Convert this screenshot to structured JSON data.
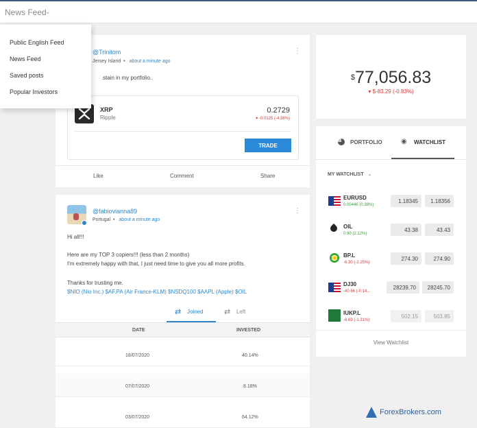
{
  "topbar": {
    "title": "News Feed"
  },
  "menu": {
    "items": [
      "Public English Feed",
      "News Feed",
      "Saved posts",
      "Popular Investors"
    ]
  },
  "post1": {
    "username": "@Trinitom",
    "location": "Jersey Island",
    "time": "about a minute ago",
    "text": "stain in my portfolio..",
    "instrument": {
      "symbol": "XRP",
      "name": "Ripple",
      "price": "0.2729",
      "change": "-0.0125 (-4.38%)",
      "trade_label": "TRADE"
    },
    "actions": {
      "like": "Like",
      "comment": "Comment",
      "share": "Share"
    }
  },
  "post2": {
    "username": "@fabiovianna89",
    "location": "Portugal",
    "time": "about a minute ago",
    "lines": [
      "Hi all!!!",
      "Here are my TOP 3 copiers!!! (less than 2 months)",
      "I'm extremely happy with that, I just need time to give you all more profits.",
      "Thanks for trusting me."
    ],
    "tags": "$NIO (Nio Inc.) $AF.PA (Air France-KLM) $NSDQ100 $AAPL (Apple) $OIL",
    "tabs": {
      "joined": "Joined",
      "left": "Left"
    },
    "table": {
      "headers": [
        "DATE",
        "INVESTED"
      ],
      "rows": [
        [
          "18/07/2020",
          "40.14%"
        ],
        [
          "07/07/2020",
          "8.18%"
        ],
        [
          "03/07/2020",
          "64.12%"
        ]
      ]
    }
  },
  "equity": {
    "currency": "$",
    "value": "77,056.83",
    "change": "$-83.29 (-0.83%)"
  },
  "watchlist": {
    "tabs": {
      "portfolio": "PORTFOLIO",
      "watchlist": "WATCHLIST"
    },
    "title": "MY WATCHLIST",
    "items": [
      {
        "symbol": "EURUSD",
        "change": "0.00446 (0.38%)",
        "change_color": "#3a9a3a",
        "sell": "1.18345",
        "buy": "1.18356",
        "dim": false
      },
      {
        "symbol": "OIL",
        "change": "0.90 (2.12%)",
        "change_color": "#3a9a3a",
        "sell": "43.38",
        "buy": "43.43",
        "dim": false
      },
      {
        "symbol": "BP.L",
        "change": "-6.30 (-2.25%)",
        "change_color": "#d23c3c",
        "sell": "274.30",
        "buy": "274.90",
        "dim": false
      },
      {
        "symbol": "DJ30",
        "change": "-40.66 (-0.14...",
        "change_color": "#d23c3c",
        "sell": "28239.70",
        "buy": "28245.70",
        "dim": false
      },
      {
        "symbol": "IUKP.L",
        "change": "-6.69 (-1.31%)",
        "change_color": "#d23c3c",
        "sell": "502.15",
        "buy": "503.85",
        "dim": true
      }
    ],
    "view_all": "View Watchlist"
  },
  "colors": {
    "accent": "#2f87c9",
    "trade_button": "#2b8ad8",
    "positive": "#3a9a3a",
    "negative": "#d23c3c"
  },
  "watermark": "ForexBrokers.com"
}
